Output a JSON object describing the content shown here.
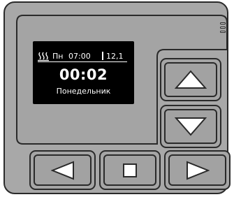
{
  "colors": {
    "body": "#a8a8a8",
    "screen": "#000000",
    "screen_text": "#ffffff",
    "outline": "#2a2a2a"
  },
  "display": {
    "heat_icon": "heating-icon",
    "day_short": "Пн",
    "time": "07:00",
    "value": "12,1",
    "clock": "00:02",
    "day_name": "Понедельник"
  },
  "buttons": {
    "up": {
      "icon": "triangle-up-icon"
    },
    "down": {
      "icon": "triangle-down-icon"
    },
    "left": {
      "icon": "triangle-left-icon"
    },
    "stop": {
      "icon": "square-stop-icon"
    },
    "right": {
      "icon": "triangle-right-icon"
    }
  }
}
